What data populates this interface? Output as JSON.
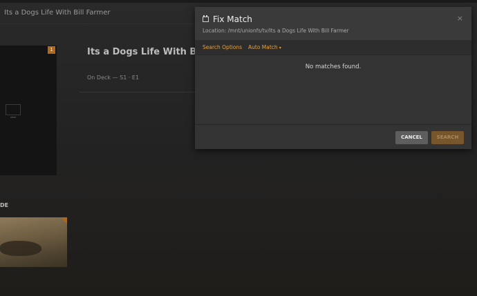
{
  "header": {
    "title": "Its a Dogs Life With Bill Farmer"
  },
  "poster": {
    "badge": "1",
    "icon": "tv-icon"
  },
  "show": {
    "title": "Its a Dogs Life With Bill Farmer",
    "ondeck_label": "On Deck",
    "episode": "— S1 · E1"
  },
  "section": {
    "label": "DE"
  },
  "modal": {
    "title": "Fix Match",
    "location": "Location: /mnt/unionfs/tv/Its a Dogs Life With Bill Farmer",
    "close": "×",
    "tabs": {
      "search_options": "Search Options",
      "auto_match": "Auto Match",
      "auto_match_caret": "▾"
    },
    "message": "No matches found.",
    "buttons": {
      "cancel": "CANCEL",
      "search": "SEARCH"
    }
  },
  "colors": {
    "accent": "#e8a33a",
    "badge": "#b0691c",
    "modal_bg": "#333333"
  }
}
